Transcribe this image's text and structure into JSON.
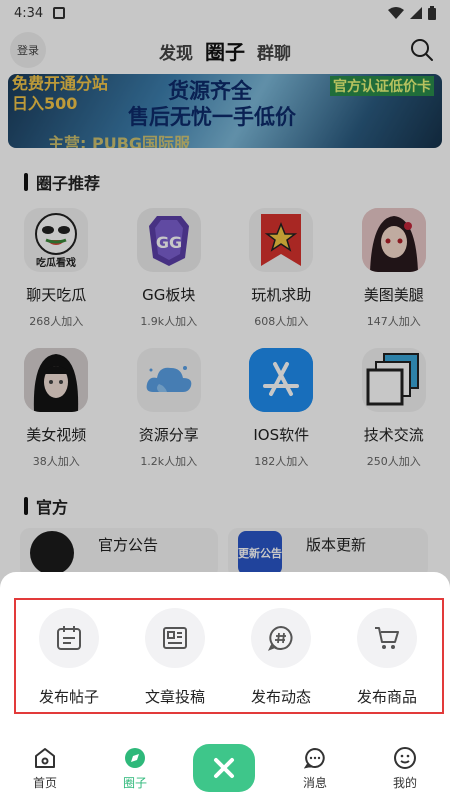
{
  "status": {
    "time": "4:34"
  },
  "header": {
    "login": "登录",
    "tabs": [
      "发现",
      "圈子",
      "群聊"
    ]
  },
  "banner": {
    "left_line1": "免费开通分站",
    "left_line2": "日入500",
    "mid_line1": "货源齐全",
    "mid_line2": "售后无忧一手低价",
    "right_tag": "官方认证低价卡",
    "bottom": "主营: PUBG国际服"
  },
  "sections": {
    "recommend_title": "圈子推荐",
    "official_title": "官方"
  },
  "circles": [
    {
      "name": "聊天吃瓜",
      "count": "268人加入",
      "icon": "meme-panda-icon"
    },
    {
      "name": "GG板块",
      "count": "1.9k人加入",
      "icon": "gg-game-icon"
    },
    {
      "name": "玩机求助",
      "count": "608人加入",
      "icon": "star-badge-icon"
    },
    {
      "name": "美图美腿",
      "count": "147人加入",
      "icon": "anime-girl-icon"
    },
    {
      "name": "美女视频",
      "count": "38人加入",
      "icon": "girl-portrait-icon"
    },
    {
      "name": "资源分享",
      "count": "1.2k人加入",
      "icon": "cloud-icon"
    },
    {
      "name": "IOS软件",
      "count": "182人加入",
      "icon": "app-store-icon"
    },
    {
      "name": "技术交流",
      "count": "250人加入",
      "icon": "stacked-squares-icon"
    }
  ],
  "panda_caption": "吃瓜看戏",
  "gg_text": "GG",
  "official": [
    {
      "name": "官方公告",
      "icon": "megaphone-icon"
    },
    {
      "name": "版本更新",
      "icon_text": "更新公告"
    }
  ],
  "actions": [
    {
      "label": "发布帖子",
      "icon": "calendar-icon"
    },
    {
      "label": "文章投稿",
      "icon": "article-icon"
    },
    {
      "label": "发布动态",
      "icon": "hashtag-chat-icon"
    },
    {
      "label": "发布商品",
      "icon": "cart-icon"
    }
  ],
  "nav": [
    {
      "label": "首页",
      "icon": "home-icon"
    },
    {
      "label": "圈子",
      "icon": "compass-icon"
    },
    {
      "label": "消息",
      "icon": "chat-icon"
    },
    {
      "label": "我的",
      "icon": "smile-icon"
    }
  ],
  "colors": {
    "accent": "#3ec68a",
    "highlight_border": "#e23a3a"
  }
}
